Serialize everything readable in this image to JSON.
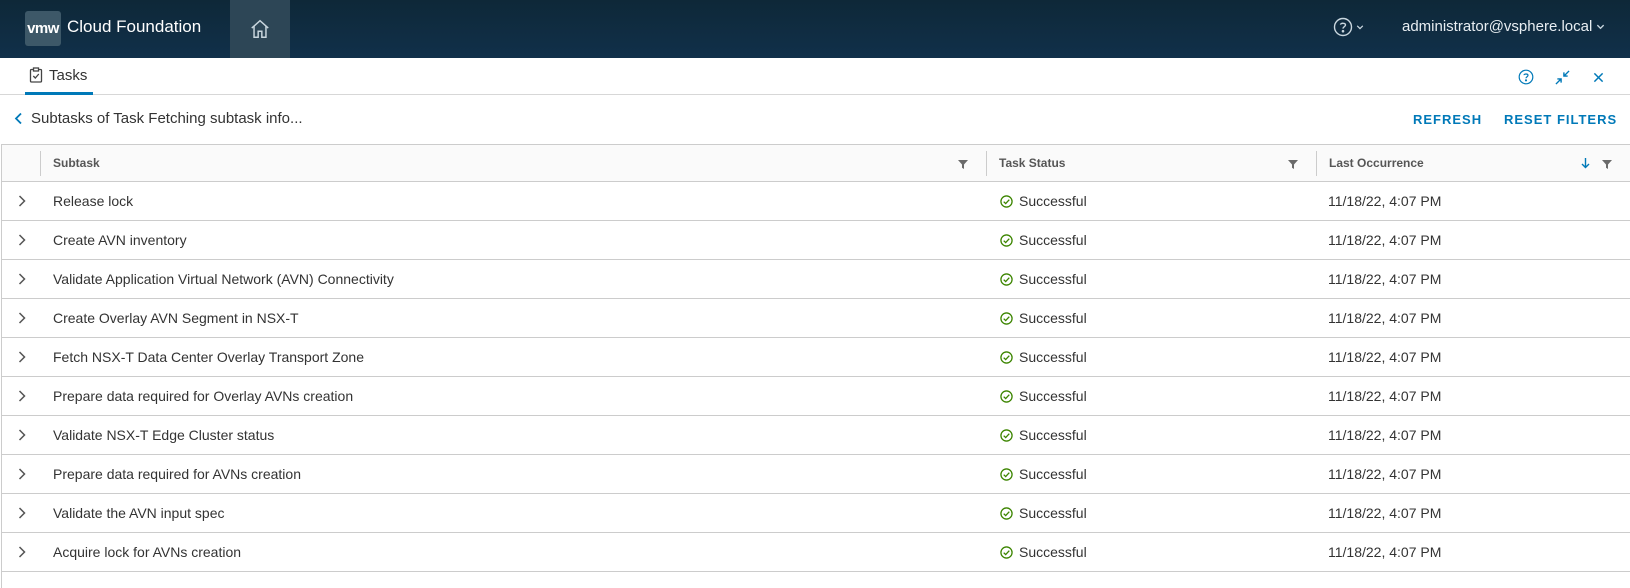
{
  "header": {
    "logo_text": "vmw",
    "app_title": "Cloud Foundation",
    "user": "administrator@vsphere.local"
  },
  "panel": {
    "tab_label": "Tasks"
  },
  "breadcrumb": {
    "title": "Subtasks of Task Fetching subtask info...",
    "refresh_label": "REFRESH",
    "reset_filters_label": "RESET FILTERS"
  },
  "grid": {
    "columns": {
      "subtask": "Subtask",
      "status": "Task Status",
      "occurrence": "Last Occurrence"
    },
    "rows": [
      {
        "subtask": "Release lock",
        "status": "Successful",
        "occurrence": "11/18/22, 4:07 PM"
      },
      {
        "subtask": "Create AVN inventory",
        "status": "Successful",
        "occurrence": "11/18/22, 4:07 PM"
      },
      {
        "subtask": "Validate Application Virtual Network (AVN) Connectivity",
        "status": "Successful",
        "occurrence": "11/18/22, 4:07 PM"
      },
      {
        "subtask": "Create Overlay AVN Segment in NSX-T",
        "status": "Successful",
        "occurrence": "11/18/22, 4:07 PM"
      },
      {
        "subtask": "Fetch NSX-T Data Center Overlay Transport Zone",
        "status": "Successful",
        "occurrence": "11/18/22, 4:07 PM"
      },
      {
        "subtask": "Prepare data required for Overlay AVNs creation",
        "status": "Successful",
        "occurrence": "11/18/22, 4:07 PM"
      },
      {
        "subtask": "Validate NSX-T Edge Cluster status",
        "status": "Successful",
        "occurrence": "11/18/22, 4:07 PM"
      },
      {
        "subtask": "Prepare data required for AVNs creation",
        "status": "Successful",
        "occurrence": "11/18/22, 4:07 PM"
      },
      {
        "subtask": "Validate the AVN input spec",
        "status": "Successful",
        "occurrence": "11/18/22, 4:07 PM"
      },
      {
        "subtask": "Acquire lock for AVNs creation",
        "status": "Successful",
        "occurrence": "11/18/22, 4:07 PM"
      }
    ]
  },
  "icons": {
    "home": "home-icon",
    "help": "help-circle-icon",
    "collapse": "collapse-icon",
    "close": "close-icon",
    "filter": "filter-icon",
    "sort": "sort-down-arrow-icon",
    "status_ok": "check-circle-icon",
    "expand": "chevron-right-icon"
  },
  "colors": {
    "header_bg": "#0f2a3a",
    "accent": "#0079b8",
    "success": "#3c8500"
  }
}
